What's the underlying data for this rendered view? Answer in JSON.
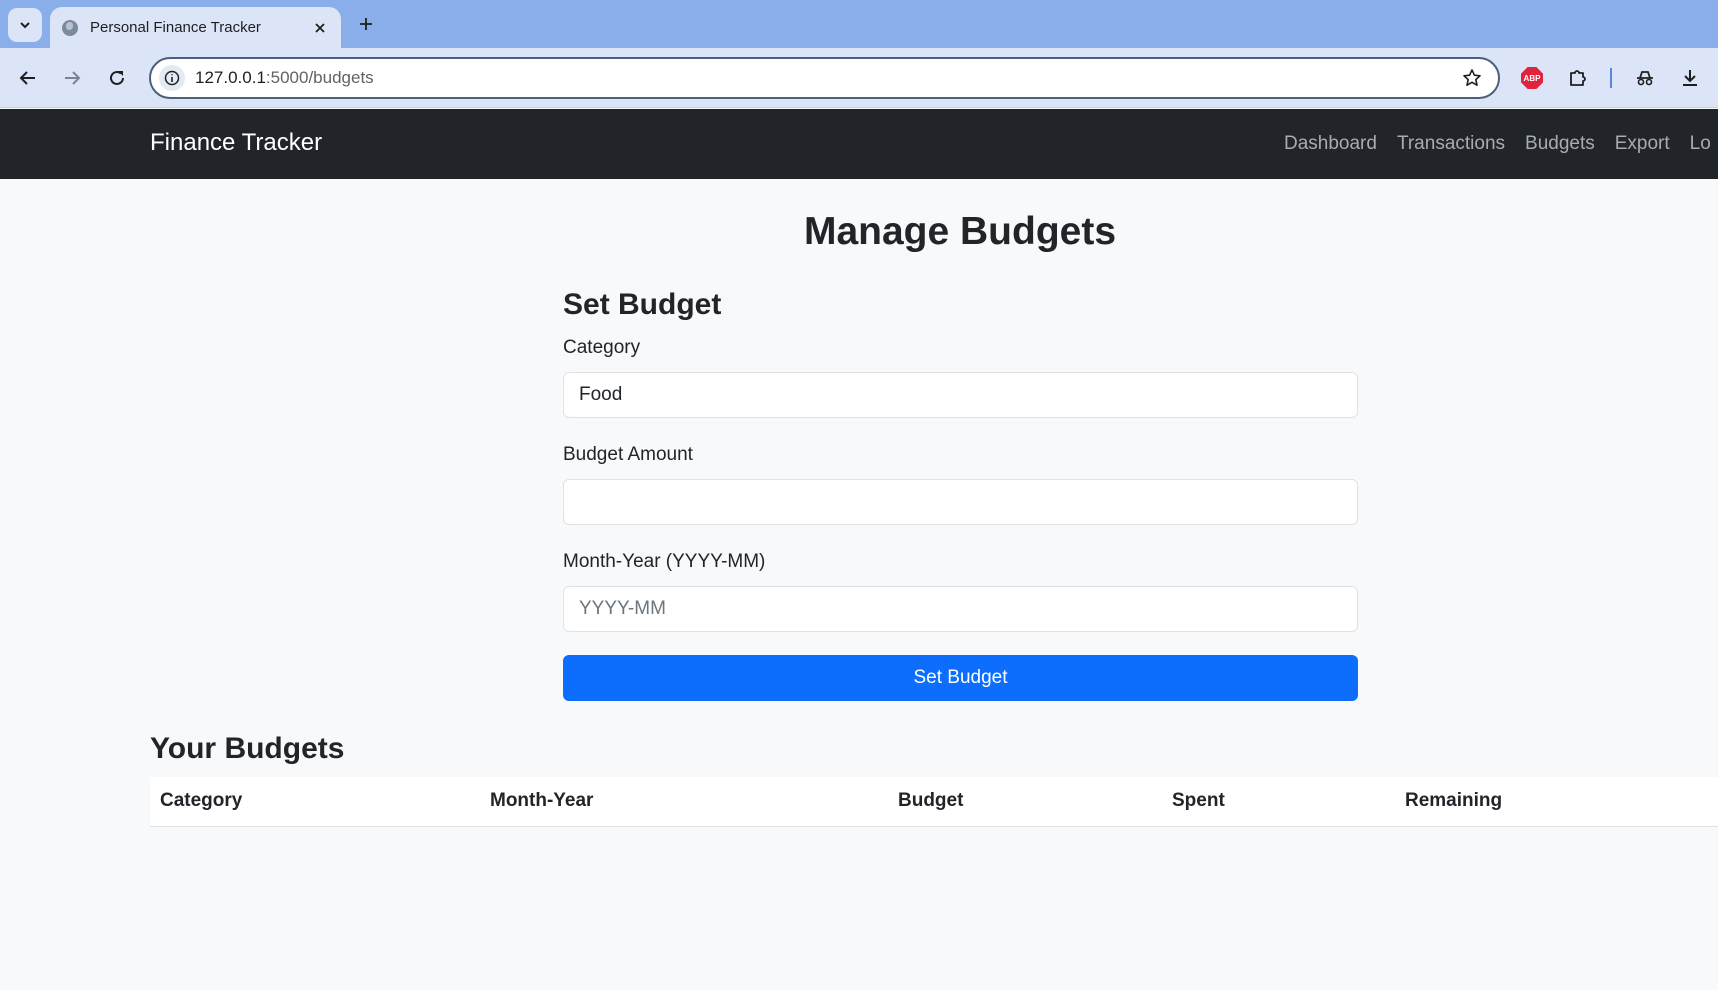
{
  "browser": {
    "tab_title": "Personal Finance Tracker",
    "url_host": "127.0.0.1",
    "url_path": ":5000/budgets"
  },
  "navbar": {
    "brand": "Finance Tracker",
    "links": [
      "Dashboard",
      "Transactions",
      "Budgets",
      "Export",
      "Lo"
    ]
  },
  "page": {
    "title": "Manage Budgets"
  },
  "form": {
    "title": "Set Budget",
    "category_label": "Category",
    "category_value": "Food",
    "amount_label": "Budget Amount",
    "amount_value": "",
    "month_label": "Month-Year (YYYY-MM)",
    "month_placeholder": "YYYY-MM",
    "submit_label": "Set Budget"
  },
  "budgets": {
    "title": "Your Budgets",
    "columns": [
      "Category",
      "Month-Year",
      "Budget",
      "Spent",
      "Remaining"
    ],
    "rows": []
  },
  "colors": {
    "navbar_bg": "#212529",
    "primary": "#0d6efd",
    "tabstrip_bg": "#8aaeea"
  }
}
